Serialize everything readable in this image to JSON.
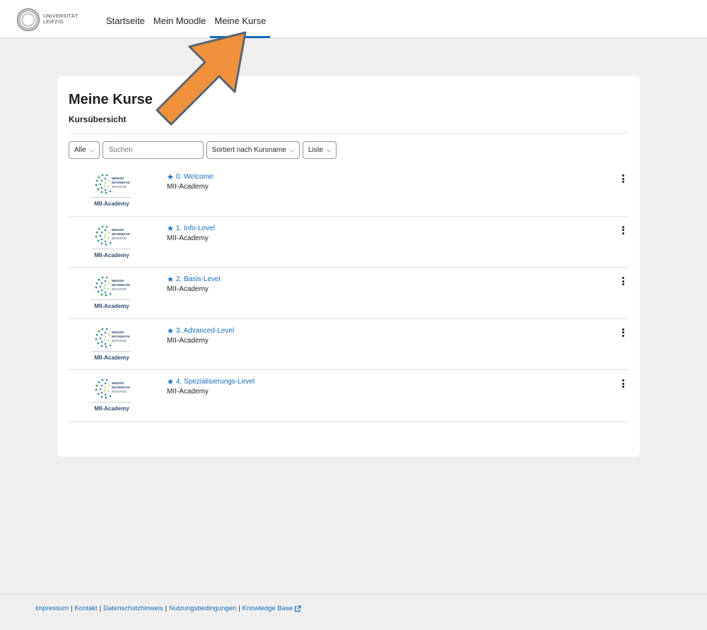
{
  "logo": {
    "text_line1": "UNIVERSITÄT",
    "text_line2": "LEIPZIG"
  },
  "nav": [
    {
      "label": "Startseite"
    },
    {
      "label": "Mein Moodle"
    },
    {
      "label": "Meine Kurse",
      "active": true
    }
  ],
  "page": {
    "title": "Meine Kurse",
    "section": "Kursübersicht"
  },
  "filters": {
    "grouping": "Alle",
    "search_placeholder": "Suchen",
    "sort": "Sortiert nach Kursname",
    "view": "Liste"
  },
  "courses": [
    {
      "name": "0. Welcome",
      "category": "MII-Academy",
      "image_label": "MII-Academy",
      "starred": true
    },
    {
      "name": "1. Info-Level",
      "category": "MII-Academy",
      "image_label": "MII-Academy",
      "starred": true
    },
    {
      "name": "2. Basis-Level",
      "category": "MII-Academy",
      "image_label": "MII-Academy",
      "starred": true
    },
    {
      "name": "3. Advanced-Level",
      "category": "MII-Academy",
      "image_label": "MII-Academy",
      "starred": true
    },
    {
      "name": "4. Spezialisierungs-Level",
      "category": "MII-Academy",
      "image_label": "MII-Academy",
      "starred": true
    }
  ],
  "footer": {
    "links": [
      "Impressum",
      "Kontakt",
      "Datenschutzhinweis",
      "Nutzungsbedingungen",
      "Knowledge Base"
    ],
    "separator": "|"
  },
  "colors": {
    "link": "#0f6cbf",
    "arrow": "#f0913c",
    "background": "#efefef"
  },
  "icons": {
    "star": "star-icon",
    "more": "kebab-menu-icon",
    "external": "external-link-icon"
  }
}
